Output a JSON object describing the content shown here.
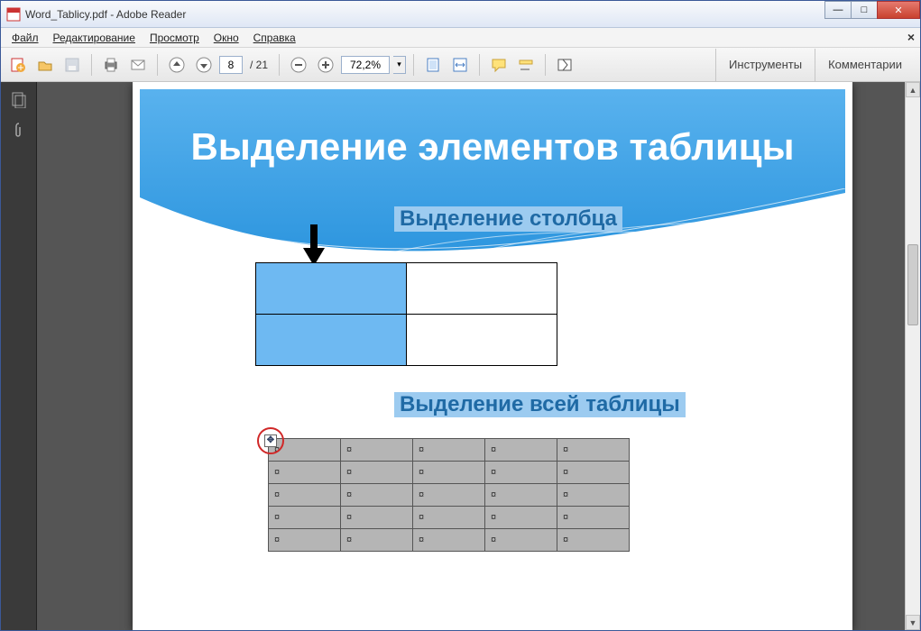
{
  "window": {
    "title": "Word_Tablicy.pdf - Adobe Reader"
  },
  "menu": {
    "file": "Файл",
    "edit": "Редактирование",
    "view": "Просмотр",
    "window": "Окно",
    "help": "Справка"
  },
  "toolbar": {
    "page_current": "8",
    "page_total": "/ 21",
    "zoom": "72,2%",
    "tools_label": "Инструменты",
    "comments_label": "Комментарии"
  },
  "document": {
    "slide_title": "Выделение элементов таблицы",
    "subtitle_column": "Выделение столбца",
    "subtitle_table": "Выделение всей таблицы",
    "cell_marker": "¤"
  }
}
